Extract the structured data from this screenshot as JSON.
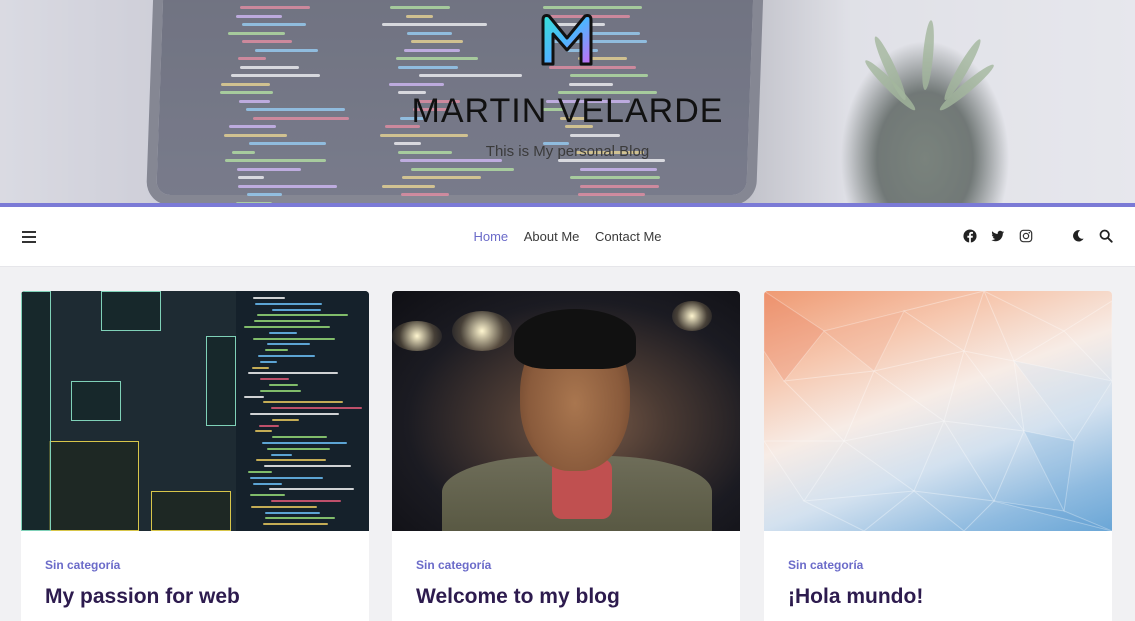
{
  "site": {
    "title": "MARTIN VELARDE",
    "tagline": "This is My personal Blog"
  },
  "nav": {
    "links": [
      {
        "label": "Home",
        "active": true
      },
      {
        "label": "About Me",
        "active": false
      },
      {
        "label": "Contact Me",
        "active": false
      }
    ],
    "icons": [
      "menu-icon",
      "facebook-icon",
      "twitter-icon",
      "instagram-icon",
      "dark-mode-icon",
      "search-icon"
    ]
  },
  "colors": {
    "accent": "#6b6bc9",
    "title": "#2d1b4e",
    "rule": "#7b7ad6"
  },
  "posts": [
    {
      "category": "Sin categoría",
      "title": "My passion for web"
    },
    {
      "category": "Sin categoría",
      "title": "Welcome to my blog"
    },
    {
      "category": "Sin categoría",
      "title": "¡Hola mundo!"
    }
  ]
}
